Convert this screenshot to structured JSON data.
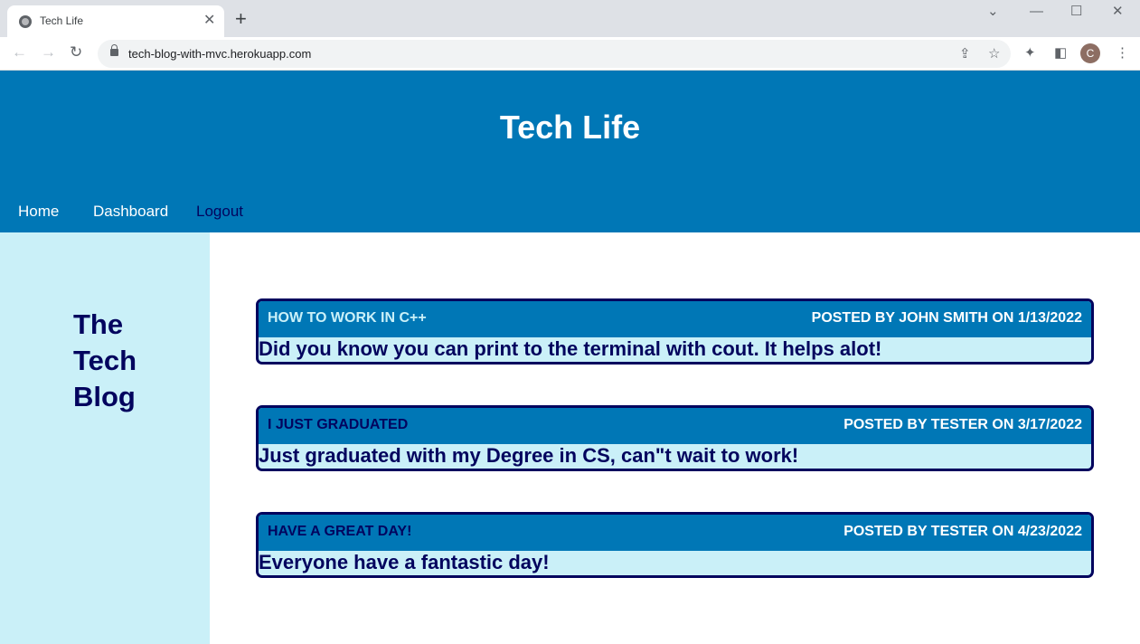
{
  "browser": {
    "tab_title": "Tech Life",
    "url": "tech-blog-with-mvc.herokuapp.com",
    "profile_initial": "C"
  },
  "site": {
    "title": "Tech Life",
    "nav": [
      {
        "label": "Home"
      },
      {
        "label": "Dashboard"
      },
      {
        "label": "Logout"
      }
    ],
    "sidebar_title_lines": [
      "The",
      "Tech",
      "Blog"
    ]
  },
  "posts": [
    {
      "title": "HOW TO WORK IN C++",
      "meta": "POSTED BY JOHN SMITH ON 1/13/2022",
      "body": "Did you know you can print to the terminal with cout. It helps alot!"
    },
    {
      "title": "I JUST GRADUATED",
      "meta": "POSTED BY TESTER ON 3/17/2022",
      "body": "Just graduated with my Degree in CS, can\"t wait to work!"
    },
    {
      "title": "HAVE A GREAT DAY!",
      "meta": "POSTED BY TESTER ON 4/23/2022",
      "body": "Everyone have a fantastic day!"
    }
  ],
  "colors": {
    "header_blue": "#0077b6",
    "navy": "#03045e",
    "light_cyan": "#caf0f8",
    "light_title": "#caf0f8"
  }
}
